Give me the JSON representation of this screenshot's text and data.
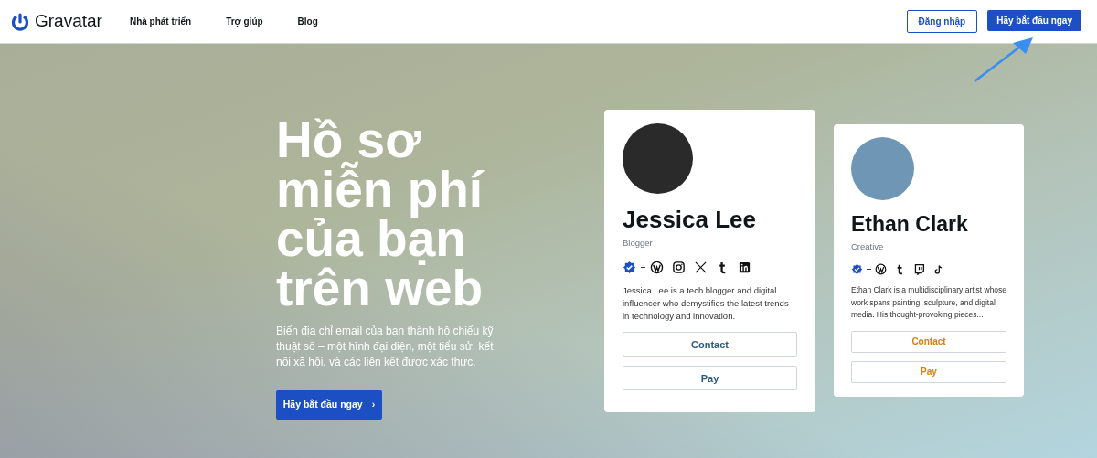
{
  "header": {
    "logo": "Gravatar",
    "nav": [
      {
        "label": "Nhà phát triển"
      },
      {
        "label": "Trợ giúp"
      },
      {
        "label": "Blog"
      }
    ],
    "login": "Đăng nhập",
    "cta": "Hãy bắt đầu ngay"
  },
  "hero": {
    "title_lines": [
      "Hồ sơ",
      "miễn phí",
      "của bạn",
      "trên web"
    ],
    "description": "Biến địa chỉ email của bạn thành hộ chiếu kỹ thuật số – một hình đại diện, một tiểu sử, kết nối xã hội, và các liên kết được xác thực.",
    "cta": "Hãy bắt đầu ngay",
    "cta_icon": "›"
  },
  "cards": [
    {
      "name": "Jessica Lee",
      "role": "Blogger",
      "color": "#2a5b84",
      "icons": [
        {
          "kind": "verified"
        },
        {
          "kind": "wordpress"
        },
        {
          "kind": "instagram"
        },
        {
          "kind": "x"
        },
        {
          "kind": "tumblr"
        },
        {
          "kind": "linkedin"
        }
      ],
      "bio": "Jessica Lee is a tech blogger and digital influencer who demystifies the latest trends in technology and innovation.",
      "buttons": [
        "Contact",
        "Pay"
      ]
    },
    {
      "name": "Ethan Clark",
      "role": "Creative",
      "color": "#d67f0e",
      "icons": [
        {
          "kind": "verified"
        },
        {
          "kind": "wordpress"
        },
        {
          "kind": "tumblr"
        },
        {
          "kind": "twitch"
        },
        {
          "kind": "tiktok"
        }
      ],
      "bio": "Ethan Clark is a multidisciplinary artist whose work spans painting, sculpture, and digital media. His thought-provoking pieces...",
      "buttons": [
        "Contact",
        "Pay"
      ]
    }
  ]
}
